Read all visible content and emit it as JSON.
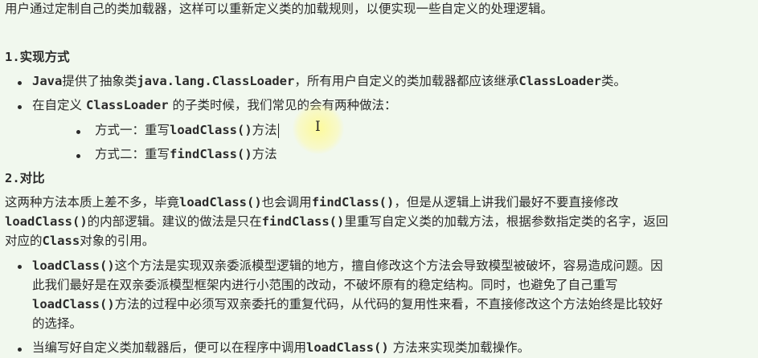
{
  "intro": "用户通过定制自己的类加载器，这样可以重新定义类的加载规则，以便实现一些自定义的处理逻辑。",
  "section1": {
    "heading": "1.实现方式",
    "bullet1": {
      "t1": "Java",
      "t2": "提供了抽象类",
      "t3": "java.lang.ClassLoader",
      "t4": "，所有用户自定义的类加载器都应该继承",
      "t5": "ClassLoader",
      "t6": "类。"
    },
    "bullet2": {
      "t1": "在自定义 ",
      "t2": "ClassLoader",
      "t3": " 的子类时候，我们常见的会有两种做法："
    },
    "sub1": {
      "t1": "方式一：重写",
      "t2": "loadClass()",
      "t3": "方法"
    },
    "sub2": {
      "t1": "方式二：重写",
      "t2": "findClass()",
      "t3": "方法"
    }
  },
  "section2": {
    "heading": "2.对比",
    "para": {
      "l1a": "这两种方法本质上差不多，毕竟",
      "l1b": "loadClass()",
      "l1c": "也会调用",
      "l1d": "findClass()",
      "l1e": "，但是从逻辑上讲我们最好不要直接修改",
      "l2a": "loadClass()",
      "l2b": "的内部逻辑。建议的做法是只在",
      "l2c": "findClass()",
      "l2d": "里重写自定义类的加载方法，根据参数指定类的名字，返回",
      "l3a": "对应的",
      "l3b": "Class",
      "l3c": "对象的引用。"
    },
    "bullet1": {
      "l1a": "loadClass()",
      "l1b": "这个方法是实现双亲委派模型逻辑的地方，擅自修改这个方法会导致模型被破坏，容易造成问题。因",
      "l2": "此我们最好是在双亲委派模型框架内进行小范围的改动，不破坏原有的稳定结构。同时，也避免了自己重写",
      "l3a": "loadClass()",
      "l3b": "方法的过程中必须写双亲委托的重复代码，从代码的复用性来看，不直接修改这个方法始终是比较好",
      "l4": "的选择。"
    },
    "bullet2": {
      "t1": "当编写好自定义类加载器后，便可以在程序中调用",
      "t2": "loadClass()",
      "t3": " 方法来实现类加载操作。"
    }
  }
}
